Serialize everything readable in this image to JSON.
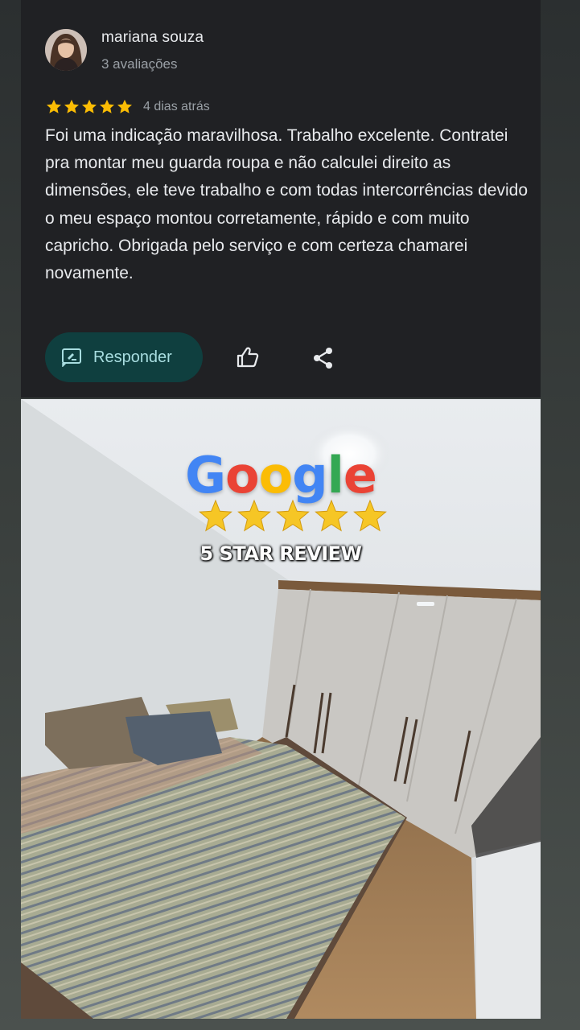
{
  "review": {
    "reviewer_name": "mariana souza",
    "reviewer_meta": "3 avaliações",
    "rating": 5,
    "date": "4 dias atrás",
    "text": "Foi uma indicação maravilhosa. Trabalho excelente. Contratei pra montar meu guarda roupa e não calculei direito as dimensões, ele teve trabalho e com todas intercorrências devido o meu espaço montou corretamente, rápido e com muito capricho. Obrigada pelo serviço e com certeza chamarei novamente."
  },
  "actions": {
    "reply_label": "Responder",
    "like_icon": "thumbs-up-icon",
    "share_icon": "share-icon",
    "reply_icon": "reply-icon"
  },
  "photo": {
    "brand_letters": [
      "G",
      "o",
      "o",
      "g",
      "l",
      "e"
    ],
    "badge_rating": 5,
    "badge_caption": "5 STAR REVIEW"
  },
  "colors": {
    "card_bg": "#202124",
    "star_color": "#fbbc04",
    "reply_bg": "#0f3f3f",
    "reply_text": "#a8dde0",
    "google_blue": "#4285f4",
    "google_red": "#ea4335",
    "google_yellow": "#fbbc05",
    "google_green": "#34a853"
  }
}
